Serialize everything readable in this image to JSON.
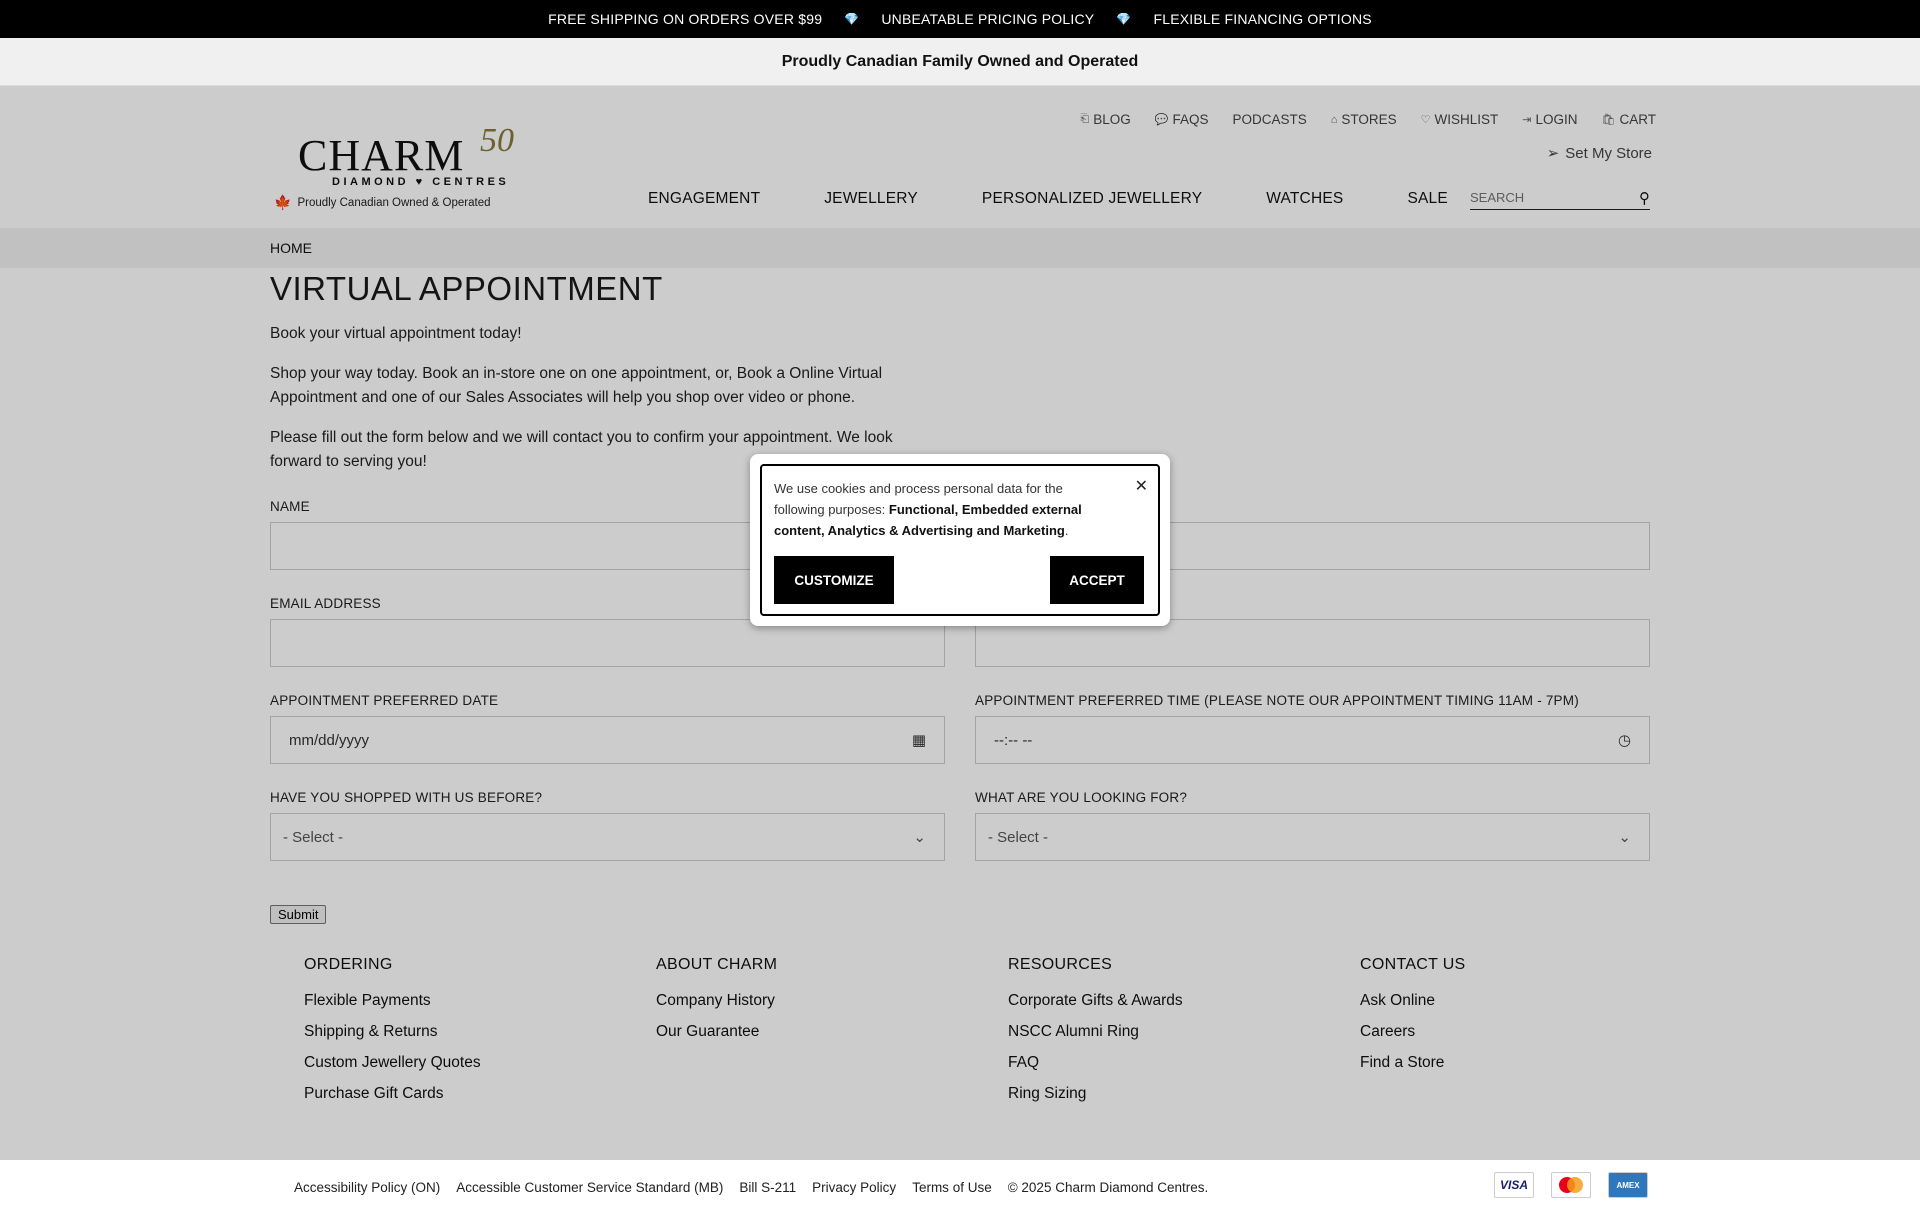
{
  "promo": {
    "items": [
      "FREE SHIPPING ON ORDERS OVER $99",
      "UNBEATABLE PRICING POLICY",
      "FLEXIBLE FINANCING OPTIONS"
    ]
  },
  "proud_banner": "Proudly Canadian Family Owned and Operated",
  "logo": {
    "brand": "CHARM",
    "anniversary": "50",
    "subtitle": "DIAMOND ♥ CENTRES",
    "tagline": "Proudly Canadian Owned & Operated"
  },
  "util_nav": [
    "BLOG",
    "FAQS",
    "PODCASTS",
    "STORES",
    "WISHLIST",
    "LOGIN",
    "CART"
  ],
  "set_store": "Set My Store",
  "main_nav": [
    "ENGAGEMENT",
    "JEWELLERY",
    "PERSONALIZED JEWELLERY",
    "WATCHES",
    "SALE"
  ],
  "search": {
    "placeholder": "SEARCH"
  },
  "breadcrumb": "HOME",
  "page": {
    "title": "VIRTUAL APPOINTMENT",
    "intro": "Book your virtual appointment today!",
    "para1": "Shop your way today. Book an in-store one on one appointment, or, Book a Online Virtual Appointment and one of our Sales Associates will help you shop over video or phone.",
    "para2": "Please fill out the form below and we will contact you to confirm your appointment. We look forward to serving you!"
  },
  "form": {
    "name_label": "NAME",
    "email_label": "EMAIL ADDRESS",
    "date_label": "APPOINTMENT PREFERRED DATE",
    "date_value": "mm/dd/yyyy",
    "time_label": "APPOINTMENT PREFERRED TIME (PLEASE NOTE OUR APPOINTMENT TIMING 11AM - 7PM)",
    "time_value": "--:-- --",
    "shopped_label": "HAVE YOU SHOPPED WITH US BEFORE?",
    "shopped_value": "- Select -",
    "looking_label": "WHAT ARE YOU LOOKING FOR?",
    "looking_value": "- Select -",
    "submit": "Submit"
  },
  "footer": {
    "columns": [
      {
        "title": "ORDERING",
        "links": [
          "Flexible Payments",
          "Shipping & Returns",
          "Custom Jewellery Quotes",
          "Purchase Gift Cards"
        ]
      },
      {
        "title": "ABOUT CHARM",
        "links": [
          "Company History",
          "Our Guarantee"
        ]
      },
      {
        "title": "RESOURCES",
        "links": [
          "Corporate Gifts & Awards",
          "NSCC Alumni Ring",
          "FAQ",
          "Ring Sizing"
        ]
      },
      {
        "title": "CONTACT US",
        "links": [
          "Ask Online",
          "Careers",
          "Find a Store"
        ]
      }
    ],
    "legal": [
      "Accessibility Policy (ON)",
      "Accessible Customer Service Standard (MB)",
      "Bill S-211",
      "Privacy Policy",
      "Terms of Use",
      "© 2025 Charm Diamond Centres."
    ],
    "cards": [
      "VISA",
      "mastercard",
      "AMERICAN EXPRESS"
    ]
  },
  "cookie": {
    "text_pre": "We use cookies and process personal data for the following purposes: ",
    "text_bold": "Functional, Embedded external content, Analytics & Advertising and Marketing",
    "text_post": ".",
    "customize": "CUSTOMIZE",
    "accept": "ACCEPT"
  },
  "colors": {
    "promo_bg": "#000000",
    "overlay": "rgba(0,0,0,0.2)",
    "button_bg": "#000000"
  }
}
